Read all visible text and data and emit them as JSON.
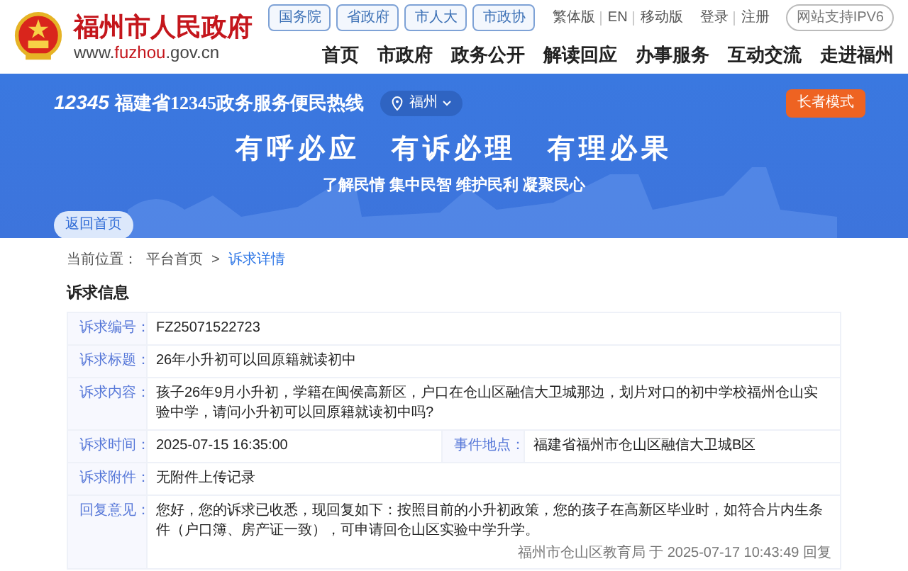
{
  "header": {
    "site_name": "福州市人民政府",
    "domain_parts": [
      {
        "text": "www.",
        "kind": "plain"
      },
      {
        "text": "fuzhou",
        "kind": "accent"
      },
      {
        "text": ".gov.cn",
        "kind": "plain"
      }
    ],
    "top_links": [
      {
        "label": "国务院",
        "kind": "badge"
      },
      {
        "label": "省政府",
        "kind": "badge"
      },
      {
        "label": "市人大",
        "kind": "badge"
      },
      {
        "label": "市政协",
        "kind": "badge"
      },
      {
        "label": "繁体版",
        "kind": "link"
      },
      {
        "label": "EN",
        "kind": "link"
      },
      {
        "label": "移动版",
        "kind": "link"
      },
      {
        "label": "登录",
        "kind": "account"
      },
      {
        "label": "注册",
        "kind": "account"
      },
      {
        "label": "网站支持IPV6",
        "kind": "pill"
      }
    ],
    "nav": [
      "首页",
      "市政府",
      "政务公开",
      "解读回应",
      "办事服务",
      "互动交流",
      "走进福州"
    ]
  },
  "banner": {
    "logo_text": "12345",
    "title": "福建省12345政务服务便民热线",
    "location": "福州",
    "elder_mode_button": "长者模式",
    "slogans": [
      "有呼必应",
      "有诉必理",
      "有理必果"
    ],
    "sub_slogan": "了解民情 集中民智 维护民利 凝聚民心",
    "back_button": "返回首页"
  },
  "breadcrumb": {
    "label": "当前位置：",
    "separator": ">",
    "items": [
      {
        "label": "平台首页",
        "selected": false
      },
      {
        "label": "诉求详情",
        "selected": true
      }
    ]
  },
  "section_title": "诉求信息",
  "rows": [
    {
      "cells": [
        {
          "label": "诉求编号：",
          "value": "FZ25071522723"
        }
      ]
    },
    {
      "cells": [
        {
          "label": "诉求标题：",
          "value": "26年小升初可以回原籍就读初中"
        }
      ]
    },
    {
      "cells": [
        {
          "label": "诉求内容：",
          "value": "孩子26年9月小升初，学籍在闽侯高新区，户口在仓山区融信大卫城那边，划片对口的初中学校福州仓山实验中学，请问小升初可以回原籍就读初中吗?"
        }
      ]
    },
    {
      "cells": [
        {
          "label": "诉求时间：",
          "value": "2025-07-15 16:35:00"
        },
        {
          "label": "事件地点：",
          "value": "福建省福州市仓山区融信大卫城B区"
        }
      ]
    },
    {
      "cells": [
        {
          "label": "诉求附件：",
          "value": "无附件上传记录"
        }
      ]
    },
    {
      "cells": [
        {
          "label": "回复意见：",
          "value": "您好，您的诉求已收悉，现回复如下：按照目前的小升初政策，您的孩子在高新区毕业时，如符合片内生条件（户口簿、房产证一致），可申请回仓山区实验中学升学。",
          "note": "福州市仓山区教育局 于 2025-07-17 10:43:49 回复"
        }
      ]
    }
  ]
}
